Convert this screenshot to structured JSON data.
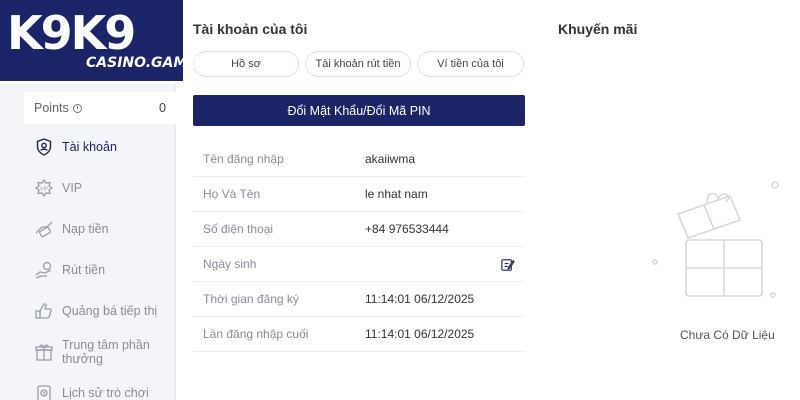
{
  "logo": {
    "main": "K9K9",
    "sub": "CASINO.GAMES"
  },
  "sidebar": {
    "points_label": "Points",
    "points_value": "0",
    "items": [
      {
        "label": "Tài khoản",
        "icon": "shield-user-icon",
        "active": true
      },
      {
        "label": "VIP",
        "icon": "vip-badge-icon"
      },
      {
        "label": "Nạp tiền",
        "icon": "deposit-icon"
      },
      {
        "label": "Rút tiền",
        "icon": "withdraw-icon"
      },
      {
        "label": "Quảng bá tiếp thị",
        "icon": "promote-icon"
      },
      {
        "label": "Trung tâm phần thưởng",
        "icon": "gift-box-icon"
      },
      {
        "label": "Lịch sử trò chơi",
        "icon": "history-icon"
      }
    ]
  },
  "account": {
    "title": "Tài khoản của tôi",
    "tabs": [
      "Hồ sơ",
      "Tài khoản rút tiền",
      "Ví tiền của tôi"
    ],
    "change_button": "Đổi Mật Khẩu/Đổi Mã PIN",
    "rows": [
      {
        "label": "Tên đăng nhập",
        "value": "akaiiwma"
      },
      {
        "label": "Họ Và Tên",
        "value": "le nhat nam"
      },
      {
        "label": "Số điện thoại",
        "value": "+84 976533444"
      },
      {
        "label": "Ngày sinh",
        "value": ""
      },
      {
        "label": "Thời gian đăng ký",
        "value": "11:14:01 06/12/2025"
      },
      {
        "label": "Lần đăng nhập cuối",
        "value": "11:14:01 06/12/2025"
      }
    ]
  },
  "promotions": {
    "title": "Khuyến mãi",
    "empty_text": "Chưa Có Dữ Liệu",
    "empty_icon": "empty-gift-icon"
  },
  "colors": {
    "brand": "#1b2467",
    "sidebar_bg": "#f4f5f8",
    "muted_text": "#8a8d96"
  }
}
